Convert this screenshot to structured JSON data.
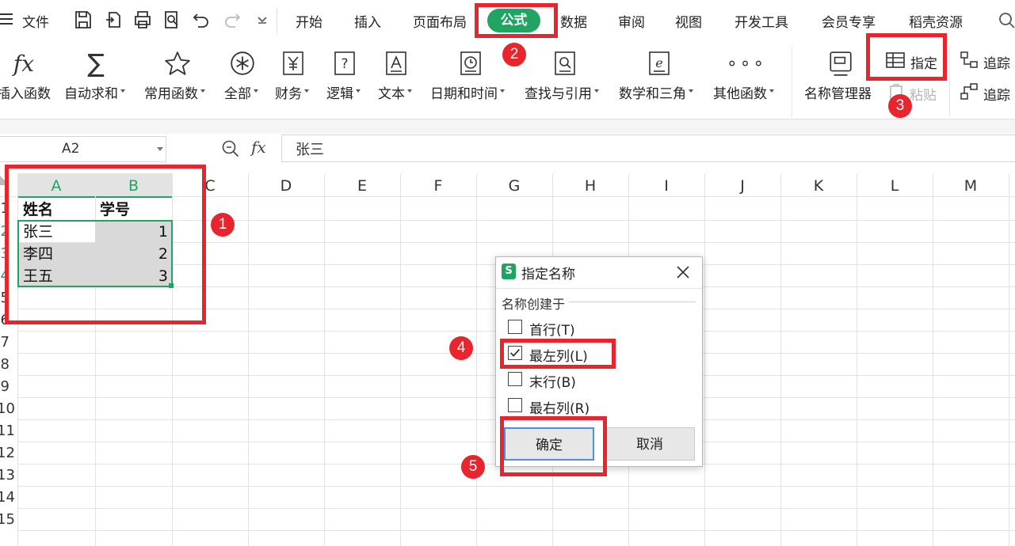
{
  "menubar": {
    "file_label": "文件",
    "tabs": [
      "开始",
      "插入",
      "页面布局",
      "公式",
      "数据",
      "审阅",
      "视图",
      "开发工具",
      "会员专享",
      "稻壳资源"
    ],
    "active_tab": "公式"
  },
  "ribbon": {
    "buttons": [
      "插入函数",
      "自动求和",
      "常用函数",
      "全部",
      "财务",
      "逻辑",
      "文本",
      "日期和时间",
      "查找与引用",
      "数学和三角",
      "其他函数",
      "名称管理器"
    ],
    "specify_label": "指定",
    "paste_label": "粘贴",
    "trace_labels": [
      "追踪",
      "追踪"
    ]
  },
  "formula_bar": {
    "name_box": "A2",
    "fx_symbol": "fx",
    "value": "张三"
  },
  "grid": {
    "columns": [
      "A",
      "B",
      "C",
      "D",
      "E",
      "F",
      "G",
      "H",
      "I",
      "J",
      "K",
      "L",
      "M"
    ],
    "rows": [
      "1",
      "2",
      "3",
      "4",
      "5",
      "6",
      "7",
      "8",
      "9",
      "10",
      "11",
      "12",
      "13",
      "14",
      "15"
    ],
    "header": [
      "姓名",
      "学号"
    ],
    "data": [
      [
        "张三",
        "1"
      ],
      [
        "李四",
        "2"
      ],
      [
        "王五",
        "3"
      ]
    ]
  },
  "dialog": {
    "title": "指定名称",
    "group_label": "名称创建于",
    "options": [
      {
        "label": "首行(T)",
        "checked": false
      },
      {
        "label": "最左列(L)",
        "checked": true
      },
      {
        "label": "末行(B)",
        "checked": false
      },
      {
        "label": "最右列(R)",
        "checked": false
      }
    ],
    "ok_label": "确定",
    "cancel_label": "取消"
  },
  "annotations": [
    "1",
    "2",
    "3",
    "4",
    "5"
  ],
  "colors": {
    "accent": "#1fa462",
    "annotation": "#e8242c"
  }
}
